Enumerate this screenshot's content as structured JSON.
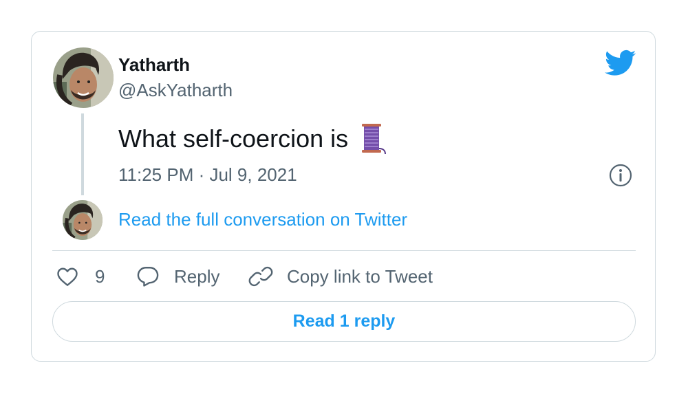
{
  "author": {
    "display_name": "Yatharth",
    "handle": "@AskYatharth"
  },
  "tweet": {
    "text": "What self-coercion is",
    "emoji": "spool-of-thread-icon",
    "timestamp": "11:25 PM · Jul 9, 2021"
  },
  "thread": {
    "read_full_label": "Read the full conversation on Twitter"
  },
  "actions": {
    "like_count": "9",
    "reply_label": "Reply",
    "copy_label": "Copy link to Tweet"
  },
  "footer": {
    "read_reply_label": "Read 1 reply"
  },
  "colors": {
    "twitter_blue": "#1d9bf0",
    "text_primary": "#0f1419",
    "text_secondary": "#536471",
    "border": "#cfd9de"
  },
  "icons": {
    "brand": "twitter-bird-icon",
    "info": "info-icon",
    "like": "heart-icon",
    "reply": "speech-bubble-icon",
    "copy": "link-icon"
  }
}
